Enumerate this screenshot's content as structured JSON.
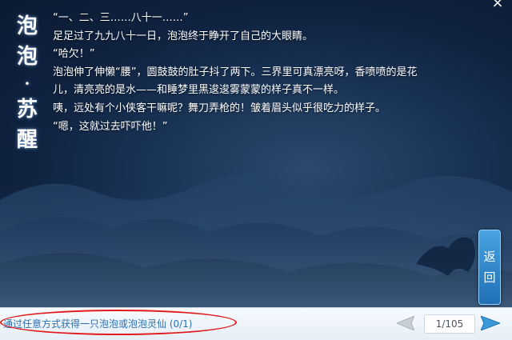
{
  "title_chars": [
    "泡",
    "泡",
    "·",
    "苏",
    "醒"
  ],
  "story_lines": [
    "“一、二、三……八十一……”",
    "足足过了九九八十一日，泡泡终于睁开了自己的大眼睛。",
    "“哈欠！”",
    "泡泡伸了伸懒“腰”，圆鼓鼓的肚子抖了两下。三界里可真漂亮呀，香喷喷的是花",
    "儿，清亮亮的是水——和睡梦里黑逡逡雾蒙蒙的样子真不一样。",
    "咦，远处有个小侠客干嘛呢？舞刀弄枪的！皱着眉头似乎很吃力的样子。",
    "“嗯，这就过去吓吓他！”"
  ],
  "close_label": "×",
  "back_button": [
    "返",
    "回"
  ],
  "quest_text": "通过任意方式获得一只泡泡或泡泡灵仙 (0/1)",
  "page_indicator": "1/105",
  "colors": {
    "accent": "#2b6fb0",
    "highlight_oval": "#e21a1a",
    "back_button": "#1f6fb5",
    "next_arrow": "#3a9ad9"
  }
}
